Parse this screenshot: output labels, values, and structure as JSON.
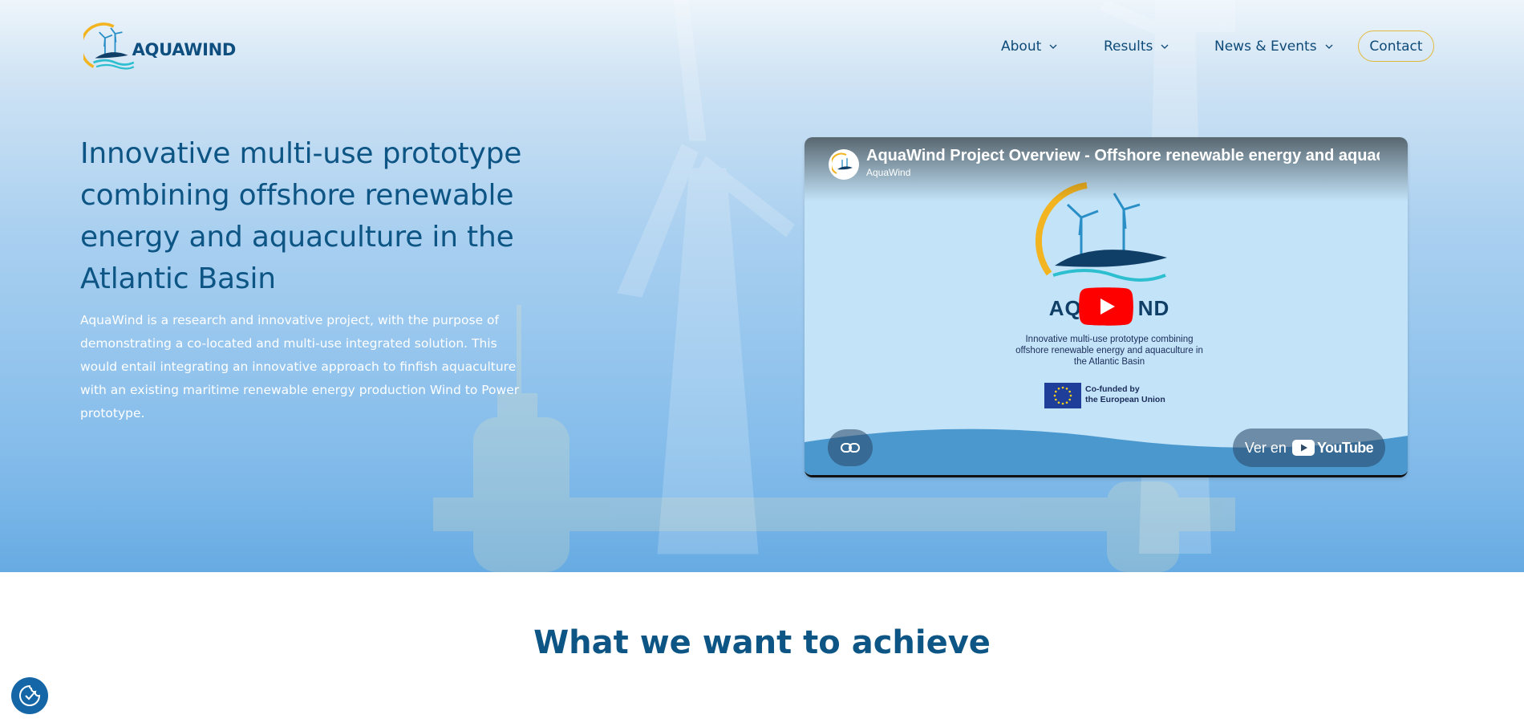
{
  "brand": {
    "name": "AQUAWIND"
  },
  "nav": {
    "items": [
      {
        "label": "About"
      },
      {
        "label": "Results"
      },
      {
        "label": "News & Events"
      }
    ],
    "contact_label": "Contact"
  },
  "hero": {
    "title": "Innovative multi-use prototype combining offshore renewable energy and aquaculture in the Atlantic Basin",
    "description": "AquaWind is a research and innovative project, with the purpose of demonstrating a co-located and multi-use integrated solution. This would entail integrating an innovative approach to finfish aquaculture with an existing maritime renewable energy production Wind to Power prototype."
  },
  "video": {
    "title": "AquaWind Project Overview - Offshore renewable energy and aquacultu",
    "channel": "AquaWind",
    "poster": {
      "subtitle": "Innovative multi-use prototype combining offshore renewable energy and aquaculture in the Atlantic Basin",
      "logo_left": "AQ",
      "logo_right": "ND",
      "eu_line1": "Co-funded by",
      "eu_line2": "the European Union"
    },
    "watch_on_label": "Ver en",
    "youtube_label": "YouTube"
  },
  "section": {
    "heading": "What we want to achieve"
  },
  "colors": {
    "primary": "#0d5584",
    "accent": "#e3b93a",
    "youtube_red": "#ff0000"
  },
  "icons": [
    "chevron-down-icon",
    "play-icon",
    "link-icon",
    "youtube-icon",
    "cookie-settings-icon",
    "logo-icon"
  ]
}
